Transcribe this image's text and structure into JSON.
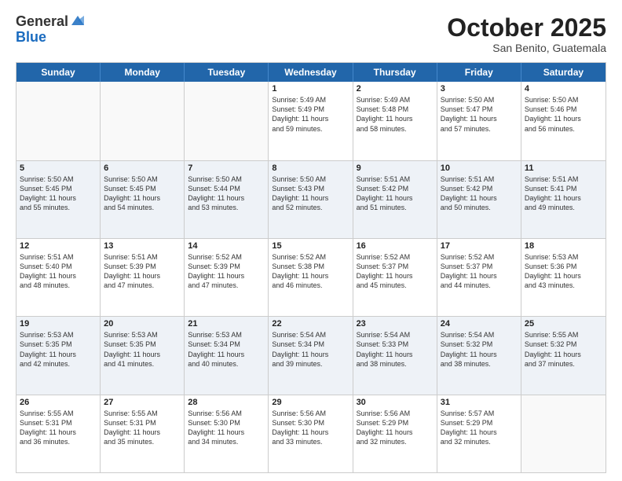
{
  "header": {
    "logo_general": "General",
    "logo_blue": "Blue",
    "month_title": "October 2025",
    "subtitle": "San Benito, Guatemala"
  },
  "days_of_week": [
    "Sunday",
    "Monday",
    "Tuesday",
    "Wednesday",
    "Thursday",
    "Friday",
    "Saturday"
  ],
  "weeks": [
    [
      {
        "day": "",
        "info": ""
      },
      {
        "day": "",
        "info": ""
      },
      {
        "day": "",
        "info": ""
      },
      {
        "day": "1",
        "info": "Sunrise: 5:49 AM\nSunset: 5:49 PM\nDaylight: 11 hours\nand 59 minutes."
      },
      {
        "day": "2",
        "info": "Sunrise: 5:49 AM\nSunset: 5:48 PM\nDaylight: 11 hours\nand 58 minutes."
      },
      {
        "day": "3",
        "info": "Sunrise: 5:50 AM\nSunset: 5:47 PM\nDaylight: 11 hours\nand 57 minutes."
      },
      {
        "day": "4",
        "info": "Sunrise: 5:50 AM\nSunset: 5:46 PM\nDaylight: 11 hours\nand 56 minutes."
      }
    ],
    [
      {
        "day": "5",
        "info": "Sunrise: 5:50 AM\nSunset: 5:45 PM\nDaylight: 11 hours\nand 55 minutes."
      },
      {
        "day": "6",
        "info": "Sunrise: 5:50 AM\nSunset: 5:45 PM\nDaylight: 11 hours\nand 54 minutes."
      },
      {
        "day": "7",
        "info": "Sunrise: 5:50 AM\nSunset: 5:44 PM\nDaylight: 11 hours\nand 53 minutes."
      },
      {
        "day": "8",
        "info": "Sunrise: 5:50 AM\nSunset: 5:43 PM\nDaylight: 11 hours\nand 52 minutes."
      },
      {
        "day": "9",
        "info": "Sunrise: 5:51 AM\nSunset: 5:42 PM\nDaylight: 11 hours\nand 51 minutes."
      },
      {
        "day": "10",
        "info": "Sunrise: 5:51 AM\nSunset: 5:42 PM\nDaylight: 11 hours\nand 50 minutes."
      },
      {
        "day": "11",
        "info": "Sunrise: 5:51 AM\nSunset: 5:41 PM\nDaylight: 11 hours\nand 49 minutes."
      }
    ],
    [
      {
        "day": "12",
        "info": "Sunrise: 5:51 AM\nSunset: 5:40 PM\nDaylight: 11 hours\nand 48 minutes."
      },
      {
        "day": "13",
        "info": "Sunrise: 5:51 AM\nSunset: 5:39 PM\nDaylight: 11 hours\nand 47 minutes."
      },
      {
        "day": "14",
        "info": "Sunrise: 5:52 AM\nSunset: 5:39 PM\nDaylight: 11 hours\nand 47 minutes."
      },
      {
        "day": "15",
        "info": "Sunrise: 5:52 AM\nSunset: 5:38 PM\nDaylight: 11 hours\nand 46 minutes."
      },
      {
        "day": "16",
        "info": "Sunrise: 5:52 AM\nSunset: 5:37 PM\nDaylight: 11 hours\nand 45 minutes."
      },
      {
        "day": "17",
        "info": "Sunrise: 5:52 AM\nSunset: 5:37 PM\nDaylight: 11 hours\nand 44 minutes."
      },
      {
        "day": "18",
        "info": "Sunrise: 5:53 AM\nSunset: 5:36 PM\nDaylight: 11 hours\nand 43 minutes."
      }
    ],
    [
      {
        "day": "19",
        "info": "Sunrise: 5:53 AM\nSunset: 5:35 PM\nDaylight: 11 hours\nand 42 minutes."
      },
      {
        "day": "20",
        "info": "Sunrise: 5:53 AM\nSunset: 5:35 PM\nDaylight: 11 hours\nand 41 minutes."
      },
      {
        "day": "21",
        "info": "Sunrise: 5:53 AM\nSunset: 5:34 PM\nDaylight: 11 hours\nand 40 minutes."
      },
      {
        "day": "22",
        "info": "Sunrise: 5:54 AM\nSunset: 5:34 PM\nDaylight: 11 hours\nand 39 minutes."
      },
      {
        "day": "23",
        "info": "Sunrise: 5:54 AM\nSunset: 5:33 PM\nDaylight: 11 hours\nand 38 minutes."
      },
      {
        "day": "24",
        "info": "Sunrise: 5:54 AM\nSunset: 5:32 PM\nDaylight: 11 hours\nand 38 minutes."
      },
      {
        "day": "25",
        "info": "Sunrise: 5:55 AM\nSunset: 5:32 PM\nDaylight: 11 hours\nand 37 minutes."
      }
    ],
    [
      {
        "day": "26",
        "info": "Sunrise: 5:55 AM\nSunset: 5:31 PM\nDaylight: 11 hours\nand 36 minutes."
      },
      {
        "day": "27",
        "info": "Sunrise: 5:55 AM\nSunset: 5:31 PM\nDaylight: 11 hours\nand 35 minutes."
      },
      {
        "day": "28",
        "info": "Sunrise: 5:56 AM\nSunset: 5:30 PM\nDaylight: 11 hours\nand 34 minutes."
      },
      {
        "day": "29",
        "info": "Sunrise: 5:56 AM\nSunset: 5:30 PM\nDaylight: 11 hours\nand 33 minutes."
      },
      {
        "day": "30",
        "info": "Sunrise: 5:56 AM\nSunset: 5:29 PM\nDaylight: 11 hours\nand 32 minutes."
      },
      {
        "day": "31",
        "info": "Sunrise: 5:57 AM\nSunset: 5:29 PM\nDaylight: 11 hours\nand 32 minutes."
      },
      {
        "day": "",
        "info": ""
      }
    ]
  ]
}
